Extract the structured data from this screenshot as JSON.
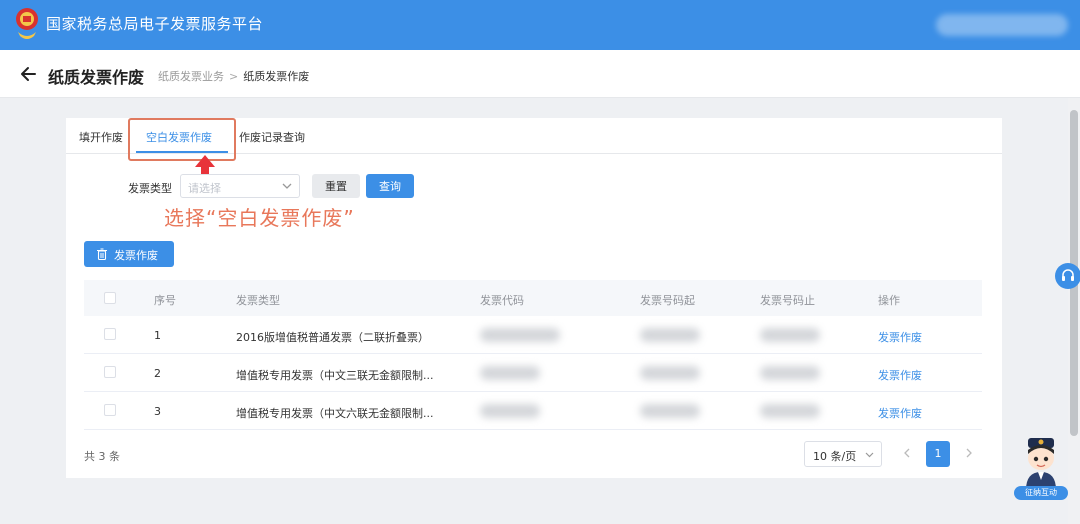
{
  "header": {
    "title": "国家税务总局电子发票服务平台"
  },
  "subheader": {
    "title": "纸质发票作废",
    "breadcrumb": [
      "纸质发票业务",
      "纸质发票作废"
    ]
  },
  "tabs": [
    {
      "label": "填开作废",
      "active": false
    },
    {
      "label": "空白发票作废",
      "active": true
    },
    {
      "label": "作废记录查询",
      "active": false
    }
  ],
  "annotation": {
    "text": "选择“空白发票作废”",
    "color": "#e8775a"
  },
  "filter": {
    "label": "发票类型",
    "placeholder": "请选择",
    "reset_label": "重置",
    "query_label": "查询"
  },
  "actions": {
    "void_label": "发票作废"
  },
  "table": {
    "columns": [
      "序号",
      "发票类型",
      "发票代码",
      "发票号码起",
      "发票号码止",
      "操作"
    ],
    "rows": [
      {
        "index": "1",
        "type": "2016版增值税普通发票（二联折叠票）",
        "action": "发票作废"
      },
      {
        "index": "2",
        "type": "增值税专用发票（中文三联无金额限制...",
        "action": "发票作废"
      },
      {
        "index": "3",
        "type": "增值税专用发票（中文六联无金额限制...",
        "action": "发票作废"
      }
    ]
  },
  "pagination": {
    "total_text": "共 3 条",
    "page_size": "10 条/页",
    "current_page": "1"
  },
  "widgets": {
    "mascot_label": "征纳互动"
  },
  "colors": {
    "primary": "#3c8fe6",
    "highlight": "#e07a5f",
    "arrow": "#e8333a"
  }
}
